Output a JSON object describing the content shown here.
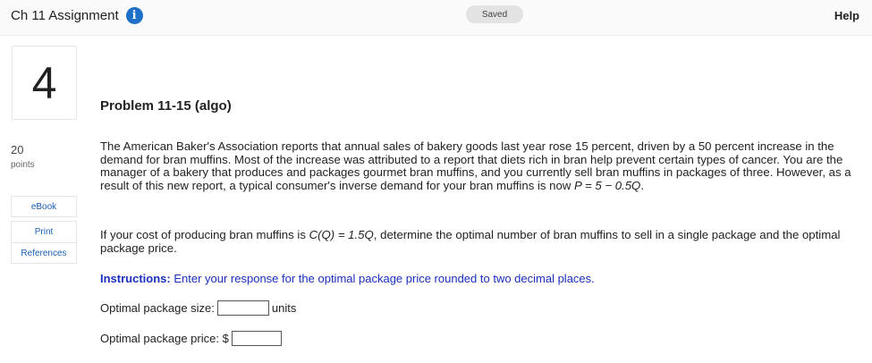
{
  "header": {
    "title": "Ch 11 Assignment",
    "info_icon": "i",
    "saved_status": "Saved",
    "help_label": "Help"
  },
  "question": {
    "number": "4",
    "points_value": "20",
    "points_label": "points"
  },
  "side_tools": {
    "ebook": "eBook",
    "print": "Print",
    "references": "References"
  },
  "problem": {
    "title": "Problem 11-15 (algo)",
    "para1_text": "The American Baker's Association reports that annual sales of bakery goods last year rose 15 percent, driven by a 50 percent increase in the demand for bran muffins. Most of the increase was attributed to a report that diets rich in bran help prevent certain types of cancer. You are the manager of a bakery that produces and packages gourmet bran muffins, and you currently sell bran muffins in packages of three. However, as a result of this new report, a typical consumer's inverse demand for your bran muffins is now ",
    "para1_math": "P = 5 − 0.5Q",
    "para1_end": ".",
    "para2_text": "If your cost of producing bran muffins is ",
    "para2_math": "C(Q) = 1.5Q",
    "para2_end": ", determine the optimal number of bran muffins to sell in a single package and the optimal package price.",
    "instructions_label": "Instructions:",
    "instructions_text": " Enter your response for the optimal package price rounded to two decimal places."
  },
  "answers": {
    "size_label": "Optimal package size:",
    "size_value": "",
    "size_unit": "units",
    "price_label": "Optimal package price: $",
    "price_value": ""
  },
  "colors": {
    "link_blue": "#1a5fb4",
    "instruction_blue": "#1a2fbd",
    "info_icon_blue": "#1e6fc8"
  }
}
